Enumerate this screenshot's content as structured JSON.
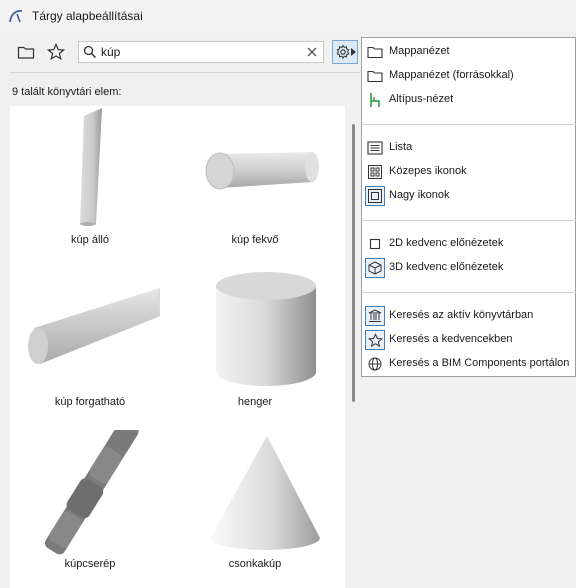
{
  "window": {
    "title": "Tárgy alapbeállításai"
  },
  "toolbar": {
    "search_value": "kúp",
    "folder_icon": "folder-icon",
    "star_icon": "star-icon",
    "gear_icon": "gear-icon"
  },
  "results": {
    "count_text": "9 talált könyvtári elem:",
    "items": [
      {
        "label": "kúp álló"
      },
      {
        "label": "kúp fekvő"
      },
      {
        "label": "kúp forgatható"
      },
      {
        "label": "henger"
      },
      {
        "label": "kúpcserép"
      },
      {
        "label": "csonkakúp"
      }
    ]
  },
  "menu": {
    "items": [
      {
        "label": "Mappanézet",
        "icon": "folder-icon"
      },
      {
        "label": "Mappanézet (forrásokkal)",
        "icon": "folder-icon"
      },
      {
        "label": "Altípus-nézet",
        "icon": "chair-icon"
      },
      {
        "label": "Lista",
        "icon": "list-icon"
      },
      {
        "label": "Közepes ikonok",
        "icon": "medium-icons-icon"
      },
      {
        "label": "Nagy ikonok",
        "icon": "large-icons-icon"
      },
      {
        "label": "2D kedvenc előnézetek",
        "icon": "square-icon"
      },
      {
        "label": "3D kedvenc előnézetek",
        "icon": "cube-icon"
      },
      {
        "label": "Keresés az aktív könyvtárban",
        "icon": "library-icon"
      },
      {
        "label": "Keresés a kedvencekben",
        "icon": "star-icon"
      },
      {
        "label": "Keresés a BIM Components portálon",
        "icon": "globe-icon"
      }
    ]
  },
  "colors": {
    "accent": "#3c7fc2",
    "menu_bg": "#ffffff",
    "window_bg": "#f0f0f0",
    "subtype_icon": "#2e9a45"
  }
}
